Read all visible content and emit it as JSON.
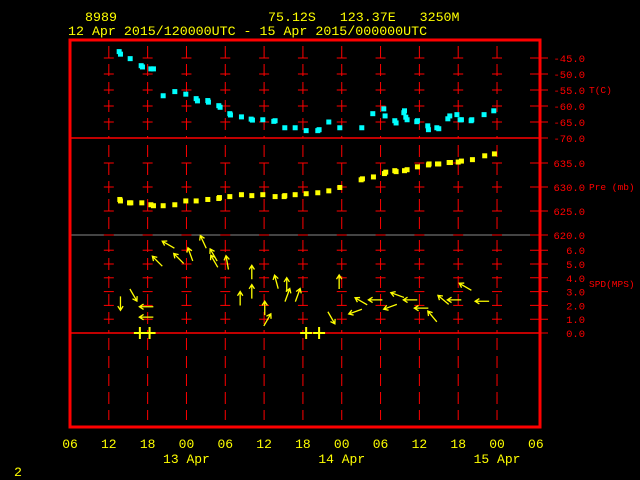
{
  "header": {
    "station_id": "8989",
    "location": "75.12S   123.37E   3250M",
    "period": "12 Apr 2015/120000UTC - 15 Apr 2015/000000UTC"
  },
  "footer": {
    "page_number": "2"
  },
  "colors": {
    "frame": "#ff0000",
    "temperature": "#00ffff",
    "pressure": "#ffff00",
    "wind": "#ffff00",
    "text": "#ffff00"
  },
  "chart_data": {
    "type": "scatter",
    "title": "8989 75.12S 123.37E 3250M",
    "subtitle": "12 Apr 2015/120000UTC - 15 Apr 2015/000000UTC",
    "x_unit": "hours since 12 Apr 2015 06UTC",
    "x_range": [
      0,
      72
    ],
    "x_ticks": [
      {
        "h": 0,
        "label": "06"
      },
      {
        "h": 6,
        "label": "12"
      },
      {
        "h": 12,
        "label": "18"
      },
      {
        "h": 18,
        "label": "00"
      },
      {
        "h": 24,
        "label": "06"
      },
      {
        "h": 30,
        "label": "12"
      },
      {
        "h": 36,
        "label": "18"
      },
      {
        "h": 42,
        "label": "00"
      },
      {
        "h": 48,
        "label": "06"
      },
      {
        "h": 54,
        "label": "12"
      },
      {
        "h": 60,
        "label": "18"
      },
      {
        "h": 66,
        "label": "00"
      },
      {
        "h": 72,
        "label": "06"
      }
    ],
    "date_labels": [
      {
        "h": 18,
        "label": "13 Apr"
      },
      {
        "h": 42,
        "label": "14 Apr"
      },
      {
        "h": 66,
        "label": "15 Apr"
      }
    ],
    "panels": [
      {
        "name": "temperature",
        "ylabel": "T(C)",
        "ylim": [
          -70,
          -45
        ],
        "ticks": [
          "-45.0",
          "-50.0",
          "-55.0",
          "-60.0",
          "-65.0",
          "-70.0"
        ],
        "tick_values": [
          -45,
          -50,
          -55,
          -60,
          -65,
          -70
        ],
        "points": [
          [
            7.6,
            -43.0
          ],
          [
            7.8,
            -43.8
          ],
          [
            9.3,
            -45.2
          ],
          [
            11.0,
            -47.4
          ],
          [
            11.2,
            -47.8
          ],
          [
            12.5,
            -48.4
          ],
          [
            12.9,
            -48.4
          ],
          [
            14.4,
            -56.8
          ],
          [
            16.2,
            -55.5
          ],
          [
            17.9,
            -56.3
          ],
          [
            19.5,
            -57.7
          ],
          [
            19.7,
            -58.4
          ],
          [
            21.3,
            -58.3
          ],
          [
            21.4,
            -58.8
          ],
          [
            23.0,
            -59.9
          ],
          [
            23.2,
            -60.4
          ],
          [
            24.7,
            -62.4
          ],
          [
            24.8,
            -62.8
          ],
          [
            26.5,
            -63.4
          ],
          [
            28.0,
            -64.1
          ],
          [
            28.2,
            -64.4
          ],
          [
            29.8,
            -64.3
          ],
          [
            31.5,
            -64.8
          ],
          [
            31.7,
            -64.6
          ],
          [
            33.2,
            -66.8
          ],
          [
            34.8,
            -66.8
          ],
          [
            36.5,
            -67.7
          ],
          [
            38.3,
            -67.7
          ],
          [
            38.5,
            -67.4
          ],
          [
            40.0,
            -65.0
          ],
          [
            41.7,
            -66.8
          ],
          [
            45.1,
            -66.8
          ],
          [
            46.8,
            -62.4
          ],
          [
            48.5,
            -60.9
          ],
          [
            48.7,
            -63.1
          ],
          [
            50.2,
            -64.6
          ],
          [
            50.4,
            -65.3
          ],
          [
            51.6,
            -62.1
          ],
          [
            51.7,
            -61.5
          ],
          [
            51.9,
            -63.5
          ],
          [
            52.1,
            -64.3
          ],
          [
            53.6,
            -64.9
          ],
          [
            53.7,
            -64.6
          ],
          [
            55.3,
            -66.2
          ],
          [
            55.4,
            -67.4
          ],
          [
            56.7,
            -66.8
          ],
          [
            57.0,
            -67.1
          ],
          [
            58.4,
            -64.0
          ],
          [
            58.7,
            -63.1
          ],
          [
            59.8,
            -62.7
          ],
          [
            60.3,
            -64.3
          ],
          [
            60.5,
            -64.3
          ],
          [
            62.0,
            -64.6
          ],
          [
            62.1,
            -64.3
          ],
          [
            64.0,
            -62.7
          ],
          [
            65.5,
            -61.5
          ]
        ]
      },
      {
        "name": "pressure",
        "ylabel": "Pre (mb)",
        "ylim": [
          620,
          637.5
        ],
        "ticks": [
          "635.0",
          "630.0",
          "625.0",
          "620.0"
        ],
        "tick_values": [
          635,
          630,
          625,
          620
        ],
        "points": [
          [
            7.7,
            627.4
          ],
          [
            7.8,
            627.1
          ],
          [
            9.2,
            626.7
          ],
          [
            9.4,
            626.7
          ],
          [
            11.1,
            626.7
          ],
          [
            12.5,
            626.3
          ],
          [
            12.9,
            626.1
          ],
          [
            14.4,
            626.1
          ],
          [
            16.2,
            626.3
          ],
          [
            17.9,
            627.1
          ],
          [
            19.5,
            627.1
          ],
          [
            21.3,
            627.4
          ],
          [
            23.0,
            627.6
          ],
          [
            23.1,
            627.8
          ],
          [
            24.7,
            628.0
          ],
          [
            26.5,
            628.4
          ],
          [
            28.1,
            628.2
          ],
          [
            29.8,
            628.4
          ],
          [
            31.7,
            628.0
          ],
          [
            33.1,
            628.0
          ],
          [
            33.2,
            628.2
          ],
          [
            34.8,
            628.4
          ],
          [
            36.5,
            628.6
          ],
          [
            38.3,
            628.8
          ],
          [
            40.0,
            629.2
          ],
          [
            41.7,
            629.9
          ],
          [
            45.0,
            631.5
          ],
          [
            45.2,
            631.7
          ],
          [
            46.9,
            632.1
          ],
          [
            48.6,
            632.8
          ],
          [
            48.8,
            633.1
          ],
          [
            50.2,
            633.4
          ],
          [
            50.4,
            633.2
          ],
          [
            51.7,
            633.4
          ],
          [
            52.1,
            633.6
          ],
          [
            53.7,
            634.2
          ],
          [
            55.4,
            634.6
          ],
          [
            55.5,
            634.8
          ],
          [
            56.8,
            634.8
          ],
          [
            57.0,
            634.8
          ],
          [
            58.6,
            635.1
          ],
          [
            58.8,
            635.1
          ],
          [
            60.0,
            635.2
          ],
          [
            60.5,
            635.4
          ],
          [
            62.2,
            635.7
          ],
          [
            64.1,
            636.5
          ],
          [
            65.6,
            636.9
          ]
        ]
      },
      {
        "name": "wind",
        "ylabel": "SPD(MPS)",
        "ylim": [
          0,
          6.5
        ],
        "ticks": [
          "6.0",
          "5.0",
          "4.0",
          "3.0",
          "2.0",
          "1.0",
          "0.0"
        ],
        "tick_values": [
          6,
          5,
          4,
          3,
          2,
          1,
          0
        ],
        "points_hour_speed_arrowdir": [
          [
            7.8,
            2.15,
            180
          ],
          [
            9.8,
            2.75,
            150
          ],
          [
            11.8,
            1.9,
            270
          ],
          [
            11.8,
            1.15,
            270
          ],
          [
            13.5,
            5.2,
            315
          ],
          [
            15.2,
            6.4,
            300
          ],
          [
            16.8,
            5.4,
            315
          ],
          [
            18.6,
            5.7,
            340
          ],
          [
            20.6,
            6.6,
            335
          ],
          [
            22.2,
            5.65,
            330
          ],
          [
            22.3,
            5.2,
            330
          ],
          [
            24.3,
            5.1,
            350
          ],
          [
            28.1,
            4.4,
            0
          ],
          [
            28.1,
            3.0,
            0
          ],
          [
            26.3,
            2.5,
            0
          ],
          [
            31.9,
            3.7,
            345
          ],
          [
            33.5,
            3.5,
            0
          ],
          [
            33.6,
            2.75,
            20
          ],
          [
            35.2,
            2.75,
            20
          ],
          [
            30.1,
            1.8,
            0
          ],
          [
            30.5,
            0.95,
            30
          ],
          [
            41.6,
            3.7,
            0
          ],
          [
            40.4,
            1.1,
            150
          ],
          [
            44.1,
            1.55,
            250
          ],
          [
            45.0,
            2.3,
            300
          ],
          [
            47.2,
            2.4,
            270
          ],
          [
            49.5,
            1.9,
            250
          ],
          [
            50.6,
            2.75,
            290
          ],
          [
            52.6,
            2.4,
            270
          ],
          [
            54.3,
            1.8,
            270
          ],
          [
            56.0,
            1.2,
            320
          ],
          [
            57.7,
            2.4,
            310
          ],
          [
            59.4,
            2.4,
            270
          ],
          [
            61.1,
            3.35,
            300
          ],
          [
            63.7,
            2.3,
            270
          ]
        ],
        "calm_hours": [
          10.8,
          12.3,
          36.5,
          38.5
        ]
      }
    ]
  }
}
